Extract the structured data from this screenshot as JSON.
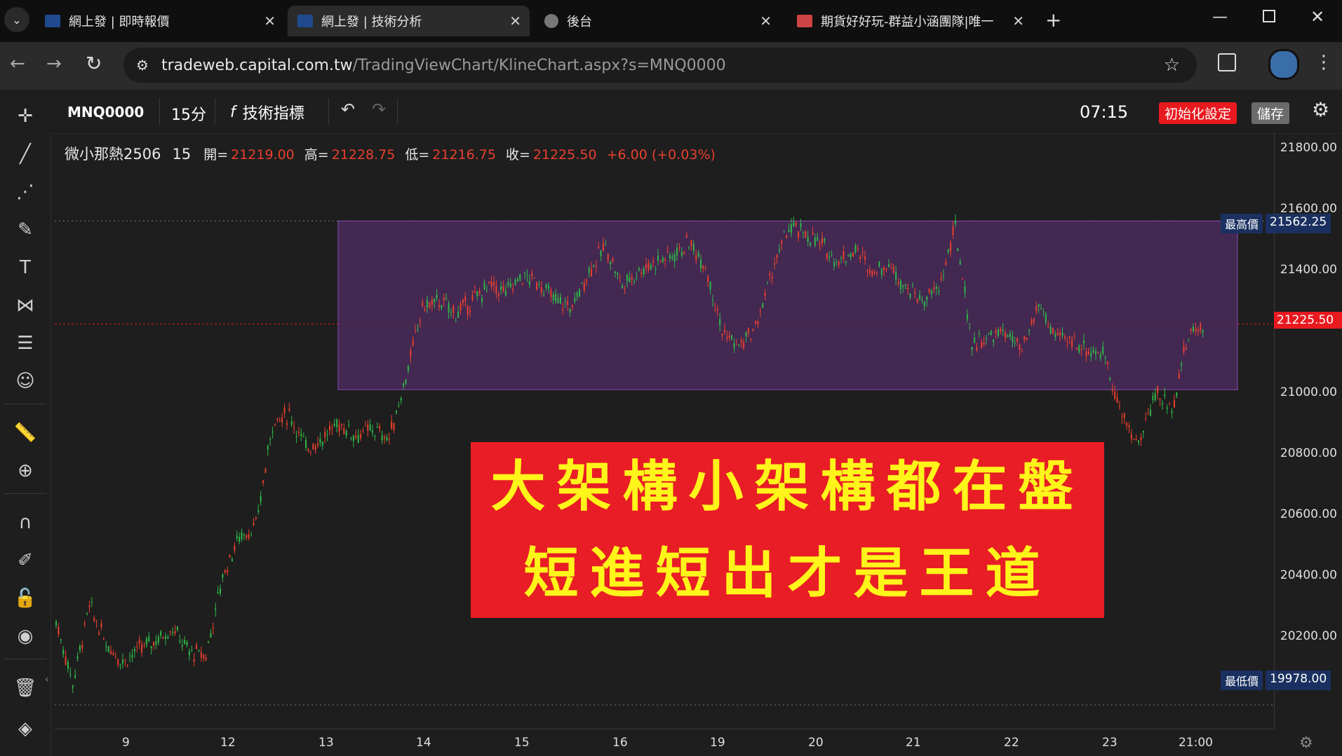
{
  "browser": {
    "tabs": [
      {
        "title": "網上發 | 即時報價",
        "active": false
      },
      {
        "title": "網上發 | 技術分析",
        "active": true
      },
      {
        "title": "後台",
        "active": false
      },
      {
        "title": "期貨好好玩-群益小涵團隊|唯一",
        "active": false
      }
    ],
    "new_tab": "+",
    "url_host": "tradeweb.capital.com.tw",
    "url_path": "/TradingViewChart/KlineChart.aspx?s=MNQ0000"
  },
  "toolbar": {
    "symbol": "MNQ0000",
    "interval": "15分",
    "indicators": "技術指標",
    "time": "07:15",
    "reset": "初始化設定",
    "save": "儲存"
  },
  "legend": {
    "name": "微小那熱2506",
    "interval": "15",
    "open_label": "開=",
    "open": "21219.00",
    "high_label": "高=",
    "high": "21228.75",
    "low_label": "低=",
    "low": "21216.75",
    "close_label": "收=",
    "close": "21225.50",
    "change": "+6.00 (+0.03%)"
  },
  "chart_data": {
    "type": "candlestick",
    "y_ticks": [
      "21800.00",
      "21600.00",
      "21400.00",
      "21000.00",
      "20800.00",
      "20600.00",
      "20400.00",
      "20200.00"
    ],
    "x_ticks": [
      "9",
      "12",
      "13",
      "14",
      "15",
      "16",
      "19",
      "20",
      "21",
      "22",
      "23",
      "21:00"
    ],
    "ylim": [
      19900,
      21850
    ],
    "high_marker": {
      "label": "最高價",
      "value": "21562.25"
    },
    "low_marker": {
      "label": "最低價",
      "value": "19978.00"
    },
    "last_price": "21225.50",
    "path_points": [
      [
        0,
        20250
      ],
      [
        2,
        20050
      ],
      [
        4,
        20300
      ],
      [
        6,
        20180
      ],
      [
        8,
        20120
      ],
      [
        10,
        20160
      ],
      [
        12,
        20190
      ],
      [
        14,
        20230
      ],
      [
        16,
        20150
      ],
      [
        18,
        20140
      ],
      [
        20,
        20400
      ],
      [
        22,
        20530
      ],
      [
        24,
        20560
      ],
      [
        26,
        20900
      ],
      [
        28,
        20930
      ],
      [
        30,
        20820
      ],
      [
        32,
        20850
      ],
      [
        34,
        20900
      ],
      [
        36,
        20860
      ],
      [
        38,
        20880
      ],
      [
        40,
        20850
      ],
      [
        42,
        21050
      ],
      [
        44,
        21280
      ],
      [
        46,
        21300
      ],
      [
        48,
        21260
      ],
      [
        50,
        21300
      ],
      [
        52,
        21350
      ],
      [
        54,
        21330
      ],
      [
        56,
        21380
      ],
      [
        58,
        21360
      ],
      [
        60,
        21300
      ],
      [
        62,
        21280
      ],
      [
        64,
        21400
      ],
      [
        66,
        21480
      ],
      [
        68,
        21350
      ],
      [
        70,
        21400
      ],
      [
        72,
        21430
      ],
      [
        74,
        21450
      ],
      [
        76,
        21490
      ],
      [
        78,
        21420
      ],
      [
        80,
        21200
      ],
      [
        82,
        21150
      ],
      [
        84,
        21210
      ],
      [
        86,
        21400
      ],
      [
        88,
        21540
      ],
      [
        90,
        21520
      ],
      [
        92,
        21480
      ],
      [
        94,
        21430
      ],
      [
        96,
        21470
      ],
      [
        98,
        21400
      ],
      [
        100,
        21420
      ],
      [
        102,
        21350
      ],
      [
        104,
        21300
      ],
      [
        106,
        21340
      ],
      [
        108,
        21540
      ],
      [
        110,
        21160
      ],
      [
        112,
        21180
      ],
      [
        114,
        21200
      ],
      [
        116,
        21130
      ],
      [
        118,
        21290
      ],
      [
        120,
        21180
      ],
      [
        122,
        21170
      ],
      [
        124,
        21140
      ],
      [
        126,
        21120
      ],
      [
        128,
        20920
      ],
      [
        130,
        20830
      ],
      [
        132,
        21000
      ],
      [
        134,
        20950
      ],
      [
        136,
        21190
      ],
      [
        138,
        21225
      ]
    ],
    "box": {
      "x_from": 13.25,
      "x_to": 23.9,
      "y_from": 21010,
      "y_to": 21562.25
    }
  },
  "banner": {
    "line1": "大架構小架構都在盤",
    "line2": "短進短出才是王道"
  },
  "colors": {
    "up": "#e8402e",
    "down": "#2fb84a",
    "box": "#6a3a8a",
    "banner_bg": "#e81d25",
    "banner_text": "#fff51a"
  }
}
